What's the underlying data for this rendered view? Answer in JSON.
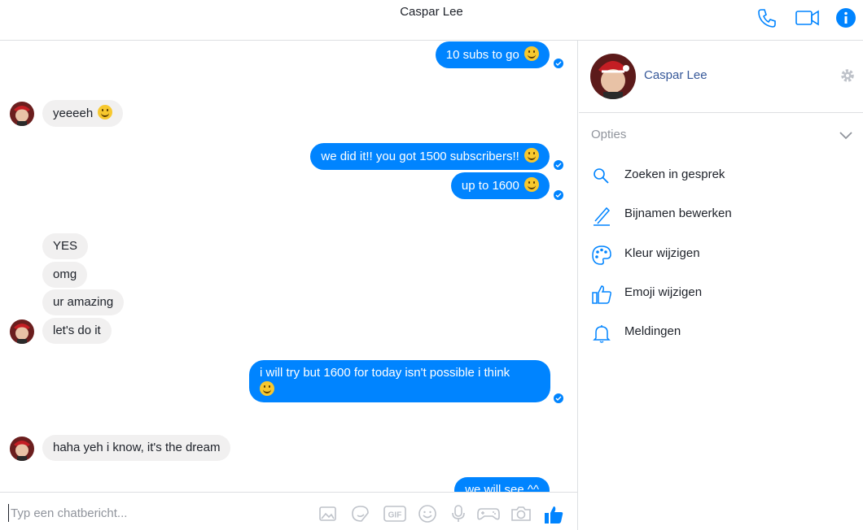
{
  "header": {
    "title": "Caspar Lee"
  },
  "icons": {
    "phone": "phone-icon",
    "video": "video-icon",
    "info": "info-icon"
  },
  "messages": [
    {
      "dir": "out",
      "text": "10 subs to go",
      "emoji": "slight-smile"
    },
    {
      "dir": "in",
      "text": "yeeeeh",
      "emoji": "grin"
    },
    {
      "dir": "out",
      "text": "we did it!! you got 1500 subscribers!!",
      "emoji": "slight-smile"
    },
    {
      "dir": "out",
      "text": "up to 1600",
      "emoji": "slight-smile"
    },
    {
      "dir": "in",
      "text": "YES"
    },
    {
      "dir": "in",
      "text": "omg"
    },
    {
      "dir": "in",
      "text": "ur amazing"
    },
    {
      "dir": "in",
      "text": "let's do it"
    },
    {
      "dir": "out",
      "text": "i will try but 1600 for today isn't possible i think",
      "emoji": "tongue"
    },
    {
      "dir": "in",
      "text": "haha yeh i know, it's the dream"
    },
    {
      "dir": "out",
      "text": "we will see ^^"
    }
  ],
  "composer": {
    "placeholder": "Typ een chatbericht...",
    "value": ""
  },
  "sidebar": {
    "name": "Caspar Lee",
    "options_heading": "Opties",
    "options": [
      {
        "label": "Zoeken in gesprek",
        "icon": "search-icon"
      },
      {
        "label": "Bijnamen bewerken",
        "icon": "pencil-icon"
      },
      {
        "label": "Kleur wijzigen",
        "icon": "palette-icon"
      },
      {
        "label": "Emoji wijzigen",
        "icon": "thumbs-up-icon"
      },
      {
        "label": "Meldingen",
        "icon": "bell-icon"
      }
    ]
  },
  "colors": {
    "accent": "#0084ff",
    "incoming_bubble": "#f1f0f0",
    "link": "#365899"
  }
}
